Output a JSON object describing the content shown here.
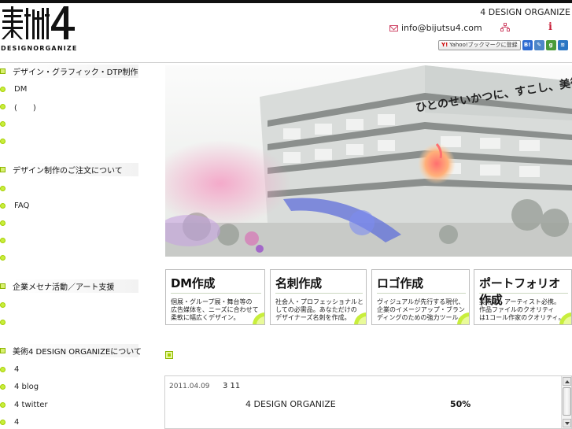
{
  "header": {
    "logo_sub": "DESIGNORGANIZE",
    "site_name": "4 DESIGN ORGANIZE",
    "email": "info@bijutsu4.com",
    "info_glyph": "i",
    "bookmarks": {
      "yahoo_label": "Yahoo!ブックマークに登録",
      "yahoo_prefix": "Y!",
      "icons": [
        {
          "name": "hatena-bookmark-icon",
          "glyph": "B!",
          "color": "#2f6bd1"
        },
        {
          "name": "livedoor-clip-icon",
          "glyph": "✎",
          "color": "#4e86c9"
        },
        {
          "name": "google-bookmark-icon",
          "glyph": "g",
          "color": "#4a9b3a"
        },
        {
          "name": "delicious-icon",
          "glyph": "≋",
          "color": "#2b76c3"
        }
      ]
    }
  },
  "sidebar": {
    "section1": {
      "title": "デザイン・グラフィック・DTP制作",
      "items": [
        "DM",
        "(　　)",
        "",
        ""
      ]
    },
    "section2": {
      "title": "デザイン制作のご注文について",
      "items": [
        "",
        "FAQ",
        "",
        "",
        ""
      ]
    },
    "section3": {
      "title": "企業メセナ活動／アート支援",
      "items": [
        "",
        ""
      ]
    },
    "section4": {
      "title": "美術4 DESIGN ORGANIZEについて",
      "items": [
        "4",
        "4 blog",
        "4 twitter",
        "4"
      ]
    }
  },
  "hero": {
    "caption": "ひとのせいかつに、すこし、美術"
  },
  "services": [
    {
      "title": "DM作成",
      "lines": [
        "個展・グループ展・舞台等の",
        "広告媒体を、ニーズに合わせて",
        "柔軟に幅広くデザイン。"
      ]
    },
    {
      "title": "名刺作成",
      "lines": [
        "社会人・プロフェッショナルと",
        "しての必需品。あなただけの",
        "デザイナーズ名刺を作成。"
      ]
    },
    {
      "title": "ロゴ作成",
      "lines": [
        "ヴィジュアルが先行する現代、",
        "企業のイメージアップ・ブラン",
        "ディングのための強力ツール。"
      ]
    },
    {
      "title": "ポートフォリオ作成",
      "lines": [
        "美術家・アーティスト必携。",
        "作品ファイルのクオリティ",
        "は1コール作家のクオリティ。"
      ]
    }
  ],
  "news": {
    "date": "2011.04.09",
    "title": "3 11",
    "body": "4 DESIGN ORGANIZE",
    "percent": "50%"
  },
  "colors": {
    "accent_green": "#c8ee3c",
    "accent_pink": "#d04a6a",
    "info_red": "#c9203a"
  }
}
